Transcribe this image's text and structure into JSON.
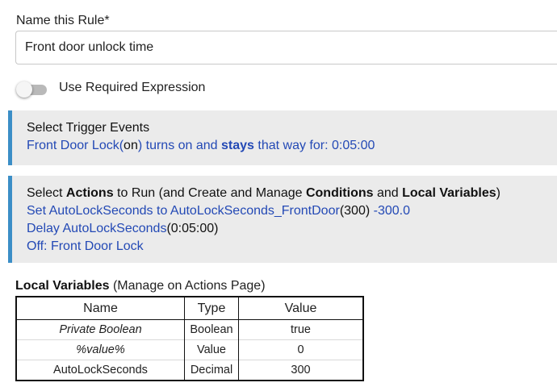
{
  "rule_name": {
    "label": "Name this Rule*",
    "value": "Front door unlock time"
  },
  "required_expression": {
    "label": "Use Required Expression",
    "enabled": false
  },
  "trigger_panel": {
    "header": "Select Trigger Events",
    "event": {
      "device": "Front Door Lock",
      "paren_open": "(",
      "state": "on",
      "paren_close": ")",
      "text1": " turns on and ",
      "stays": "stays",
      "text2": " that way for: 0:05:00"
    }
  },
  "actions_panel": {
    "header": {
      "select": "Select ",
      "actions": "Actions",
      "to_run": " to Run (and Create and Manage ",
      "conditions": "Conditions",
      "and": " and ",
      "local_variables": "Local Variables",
      "close": ")"
    },
    "action1": {
      "text": "Set AutoLockSeconds to AutoLockSeconds_FrontDoor",
      "param": "(300)",
      "result": " -300.0"
    },
    "action2": {
      "text": "Delay AutoLockSeconds",
      "param": "(0:05:00)"
    },
    "action3": {
      "text": "Off: Front Door Lock"
    }
  },
  "local_variables": {
    "title": "Local Variables",
    "subtitle": " (Manage on Actions Page)",
    "columns": [
      "Name",
      "Type",
      "Value"
    ],
    "rows": [
      {
        "name": "Private Boolean",
        "type": "Boolean",
        "value": "true"
      },
      {
        "name": "%value%",
        "type": "Value",
        "value": "0"
      },
      {
        "name": "AutoLockSeconds",
        "type": "Decimal",
        "value": "300"
      }
    ]
  },
  "colors": {
    "accent": "#3b8ec7",
    "link": "#2349b5",
    "panel_bg": "#ebebeb"
  }
}
